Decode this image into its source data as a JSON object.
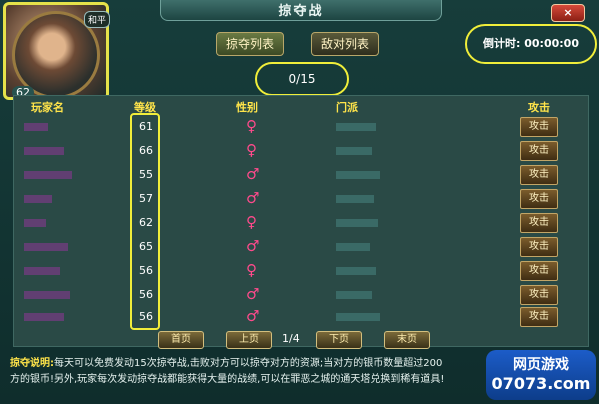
{
  "window": {
    "title": "掠夺战",
    "close_label": "×"
  },
  "avatar": {
    "badge": "和平",
    "level": "62"
  },
  "tabs": {
    "plunder": "掠夺列表",
    "enemy": "敌对列表"
  },
  "countdown": {
    "label": "倒计时:",
    "value": "00:00:00"
  },
  "plunder_count": "0/15",
  "table": {
    "headers": {
      "name": "玩家名",
      "level": "等级",
      "gender": "性别",
      "sect": "门派",
      "attack": "攻击"
    },
    "rows": [
      {
        "level": "61",
        "gender": "♀",
        "attack": "攻击"
      },
      {
        "level": "66",
        "gender": "♀",
        "attack": "攻击"
      },
      {
        "level": "55",
        "gender": "♂",
        "attack": "攻击"
      },
      {
        "level": "57",
        "gender": "♂",
        "attack": "攻击"
      },
      {
        "level": "62",
        "gender": "♀",
        "attack": "攻击"
      },
      {
        "level": "65",
        "gender": "♂",
        "attack": "攻击"
      },
      {
        "level": "56",
        "gender": "♀",
        "attack": "攻击"
      },
      {
        "level": "56",
        "gender": "♂",
        "attack": "攻击"
      },
      {
        "level": "56",
        "gender": "♂",
        "attack": "攻击"
      }
    ]
  },
  "pagination": {
    "first": "首页",
    "prev": "上页",
    "info": "1/4",
    "next": "下页",
    "last": "末页"
  },
  "description": {
    "key": "掠夺说明:",
    "line1": "每天可以免费发动15次掠夺战,击败对方可以掠夺对方的资源;当对方的银币数量超过200",
    "line2": "方的银币!另外,玩家每次发动掠夺战都能获得大量的战绩,可以在罪恶之城的通天塔兑换到稀有道具!"
  },
  "watermark": {
    "line1": "网页游戏",
    "line2": "07073.com"
  }
}
